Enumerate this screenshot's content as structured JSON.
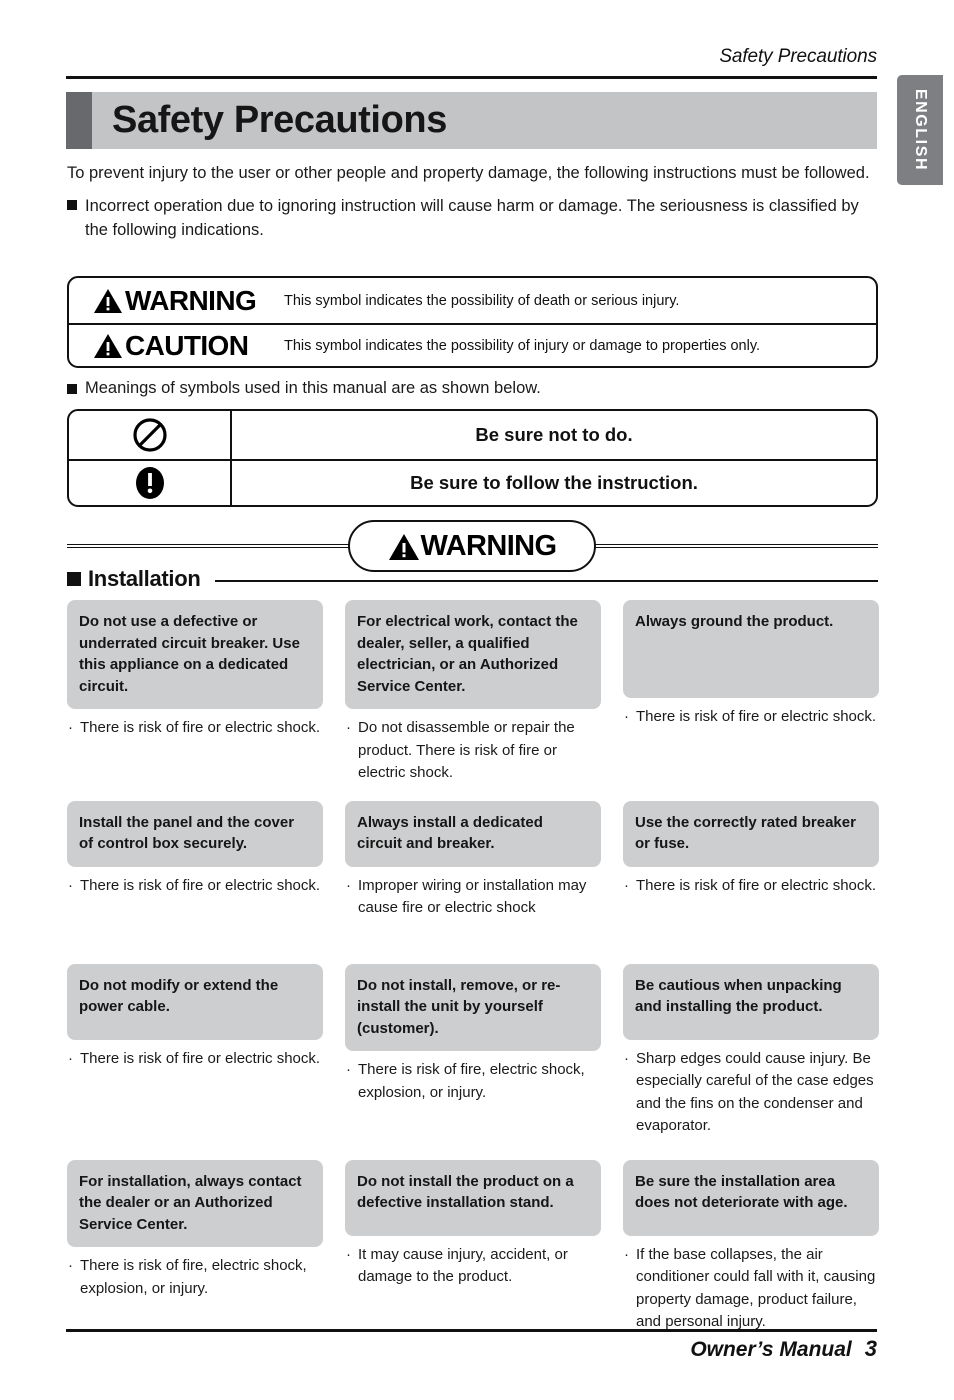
{
  "running_head": "Safety Precautions",
  "language_tab": "ENGLISH",
  "title": "Safety Precautions",
  "intro": {
    "paragraph1": "To prevent injury to the user or other people and property damage, the following instructions must be followed.",
    "paragraph2": "Incorrect operation due to ignoring instruction will cause harm or damage. The seriousness is classified by the following indications."
  },
  "legend": {
    "rows": [
      {
        "word": "WARNING",
        "icon": "warning-triangle-icon",
        "description": "This symbol indicates the possibility of death or serious injury."
      },
      {
        "word": "CAUTION",
        "icon": "warning-triangle-icon",
        "description": "This symbol indicates the possibility of injury or damage to properties only."
      }
    ]
  },
  "symbols_note": "Meanings of symbols used in this manual are as shown below.",
  "symbol_table": {
    "rows": [
      {
        "icon": "prohibition-circle-icon",
        "text": "Be sure not to do."
      },
      {
        "icon": "mandatory-exclamation-icon",
        "text": "Be sure to follow the instruction."
      }
    ]
  },
  "section_banner": {
    "word": "WARNING",
    "icon": "warning-triangle-icon"
  },
  "subsection": {
    "label": "Installation"
  },
  "cards": [
    [
      {
        "head": "Do not use a defective or underrated circuit breaker. Use this appliance on a dedicated circuit.",
        "body": "There is risk of fire or electric shock."
      },
      {
        "head": "For electrical work, contact the dealer, seller, a qualified electrician, or an Authorized Service Center.",
        "body": "Do not disassemble or repair the product. There is risk of fire or electric shock."
      },
      {
        "head": "Always ground the product.",
        "body": "There is risk of fire or electric shock."
      }
    ],
    [
      {
        "head": "Install the panel and the cover of control box securely.",
        "body": "There is risk of fire or electric shock."
      },
      {
        "head": "Always install a dedicated circuit and breaker.",
        "body": "Improper wiring or installation may cause fire or electric shock"
      },
      {
        "head": "Use the correctly rated breaker or fuse.",
        "body": "There is risk of fire or electric shock."
      }
    ],
    [
      {
        "head": "Do not modify or extend the power cable.",
        "body": "There is risk of fire or electric shock."
      },
      {
        "head": "Do not install, remove, or re-install the unit by yourself (customer).",
        "body": "There is risk of fire, electric shock, explosion, or injury."
      },
      {
        "head": "Be cautious when unpacking and installing  the product.",
        "body": "Sharp edges could cause injury. Be especially careful of the case edges and the fins on the condenser and evaporator."
      }
    ],
    [
      {
        "head": "For installation, always contact the dealer or an Authorized Service Center.",
        "body": "There is risk of fire, electric shock, explosion, or injury."
      },
      {
        "head": "Do not install the product on a defective installation stand.",
        "body": "It may cause injury, accident, or damage to the product."
      },
      {
        "head": "Be sure the installation area does not deteriorate with age.",
        "body": "If the base collapses, the air conditioner could fall with it, causing property damage, product failure, and personal injury."
      }
    ]
  ],
  "footer": {
    "manual": "Owner’s Manual",
    "page": "3"
  },
  "bullet_char": "·",
  "colors": {
    "title_band": "#c3c4c6",
    "title_swatch": "#67696c",
    "card_head_bg": "#cdced0",
    "lang_tab_bg": "#7d7f83",
    "ink": "#111111"
  }
}
